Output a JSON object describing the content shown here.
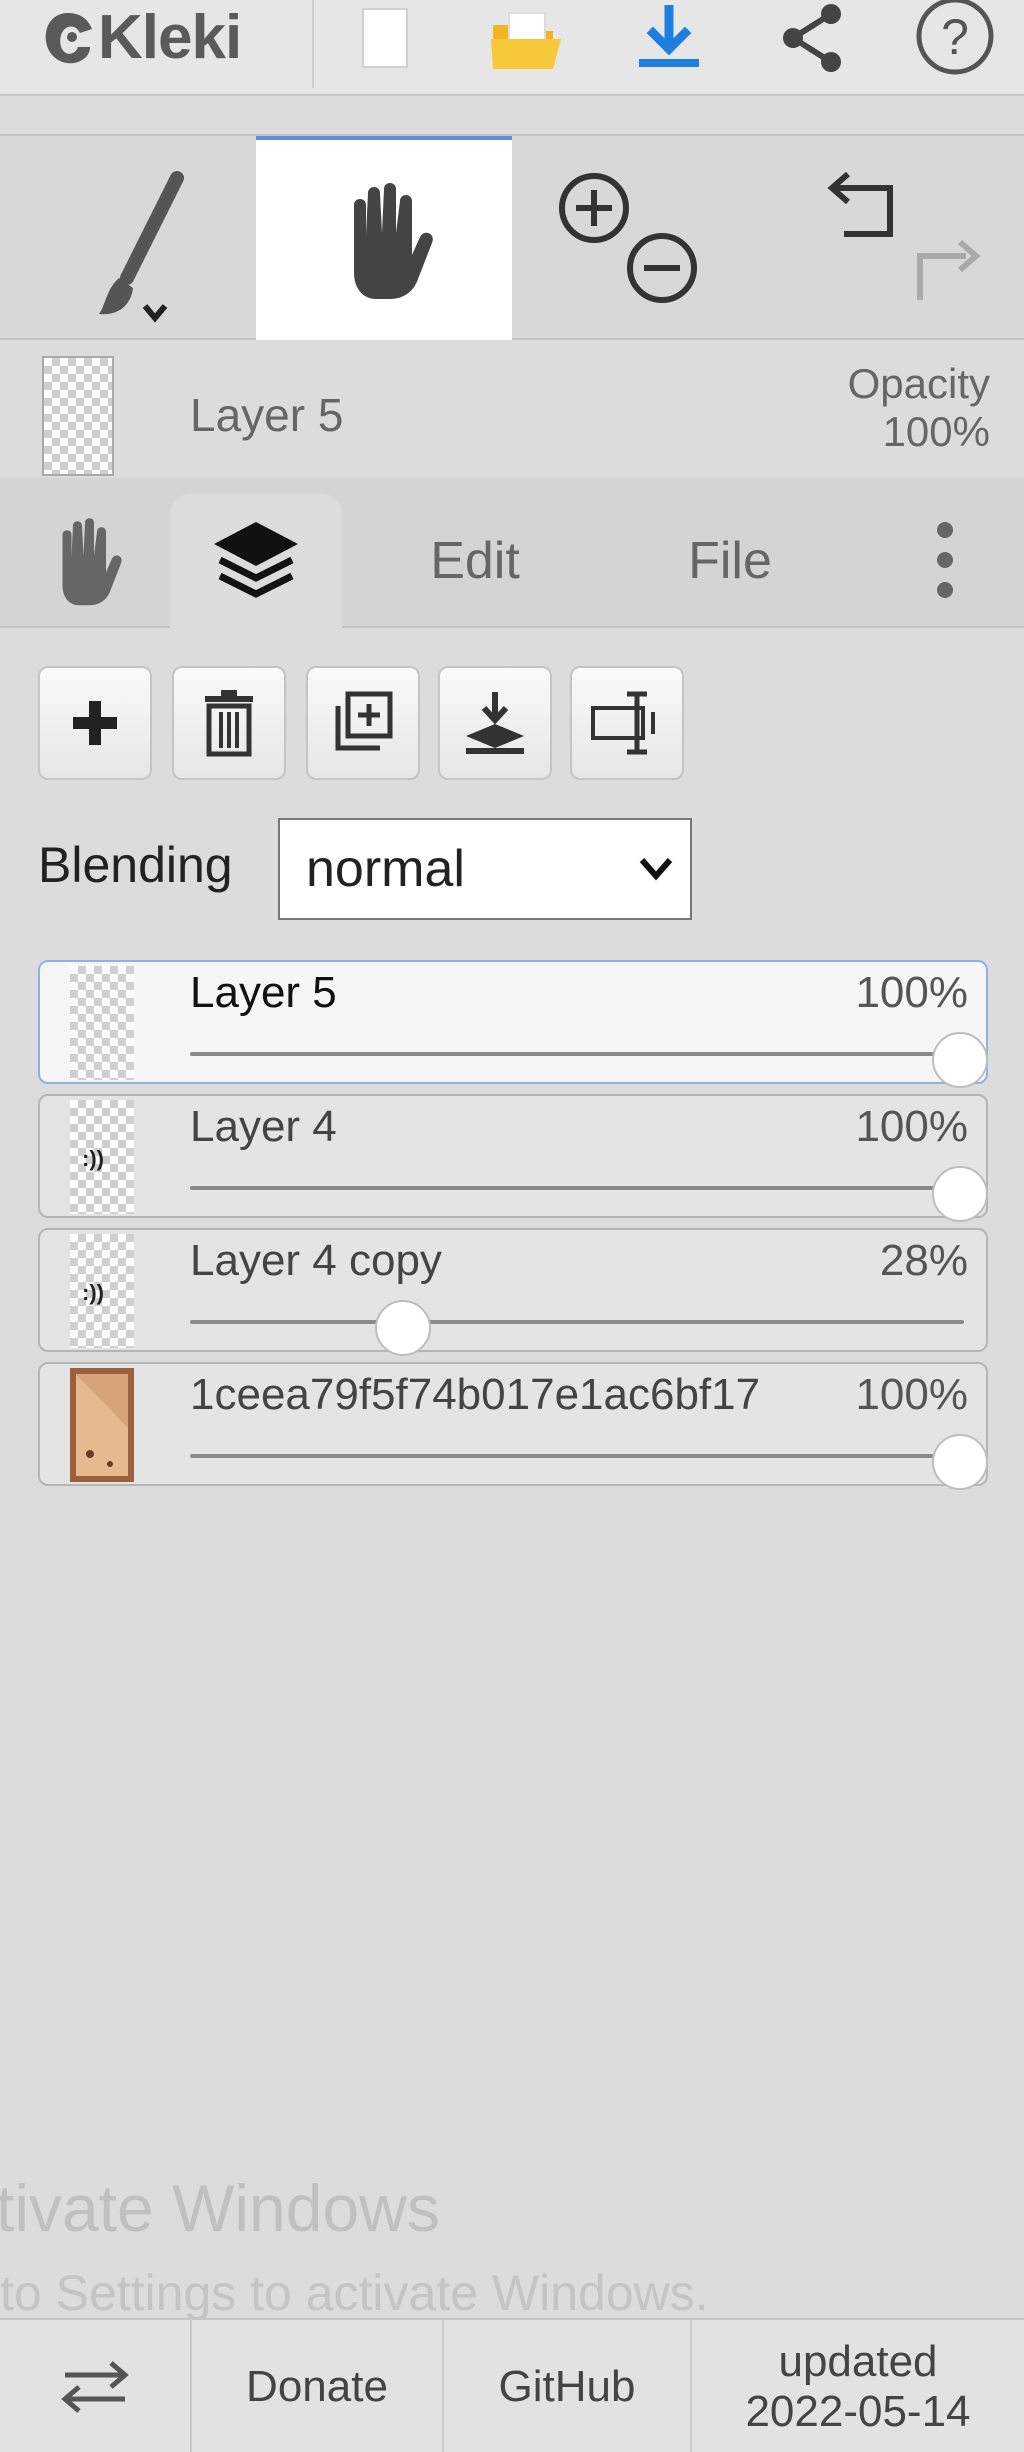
{
  "app": {
    "logo_text": "Kleki"
  },
  "header": {
    "buttons": [
      "new-image",
      "open",
      "save",
      "share",
      "help"
    ]
  },
  "tools": {
    "brush": "brush",
    "hand": "hand",
    "zoom_in": "zoom-in",
    "zoom_out": "zoom-out",
    "undo": "undo",
    "redo": "redo"
  },
  "layer_info": {
    "name": "Layer 5",
    "opacity_label": "Opacity",
    "opacity_value": "100%"
  },
  "tabs": {
    "edit": "Edit",
    "file": "File"
  },
  "blending": {
    "label": "Blending",
    "value": "normal"
  },
  "layers": [
    {
      "name": "Layer 5",
      "opacity_label": "100%",
      "opacity": 1.0,
      "selected": true
    },
    {
      "name": "Layer 4",
      "opacity_label": "100%",
      "opacity": 1.0,
      "selected": false
    },
    {
      "name": "Layer 4 copy",
      "opacity_label": "28%",
      "opacity": 0.28,
      "selected": false
    },
    {
      "name": "1ceea79f5f74b017e1ac6bf17",
      "opacity_label": "100%",
      "opacity": 1.0,
      "selected": false
    }
  ],
  "watermark": {
    "line1": "tivate Windows",
    "line2": "to Settings to activate Windows."
  },
  "footer": {
    "donate": "Donate",
    "github": "GitHub",
    "updated_label": "updated",
    "updated_date": "2022-05-14"
  }
}
